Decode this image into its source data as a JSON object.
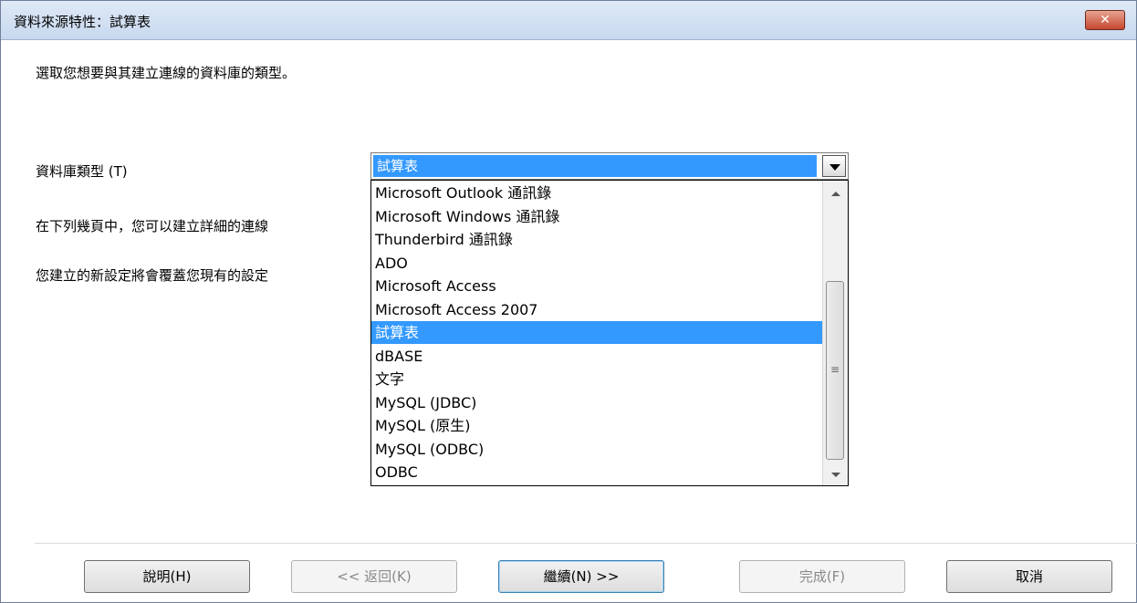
{
  "window": {
    "title": "資料來源特性：試算表",
    "close_label": "✕"
  },
  "instruction": "選取您想要與其建立連線的資料庫的類型。",
  "db_type": {
    "label": "資料庫類型 (T)",
    "selected": "試算表",
    "options": [
      "Microsoft Outlook 通訊錄",
      "Microsoft Windows 通訊錄",
      "Thunderbird 通訊錄",
      "ADO",
      "Microsoft Access",
      "Microsoft Access 2007",
      "試算表",
      "dBASE",
      "文字",
      "MySQL (JDBC)",
      "MySQL (原生)",
      "MySQL (ODBC)",
      "ODBC"
    ],
    "selected_index": 6
  },
  "notes": {
    "line1": "在下列幾頁中，您可以建立詳細的連線",
    "line2": "您建立的新設定將會覆蓋您現有的設定"
  },
  "buttons": {
    "help": "說明(H)",
    "back": "<< 返回(K)",
    "next": "繼續(N) >>",
    "finish": "完成(F)",
    "cancel": "取消"
  },
  "colors": {
    "selection": "#3399ff"
  }
}
